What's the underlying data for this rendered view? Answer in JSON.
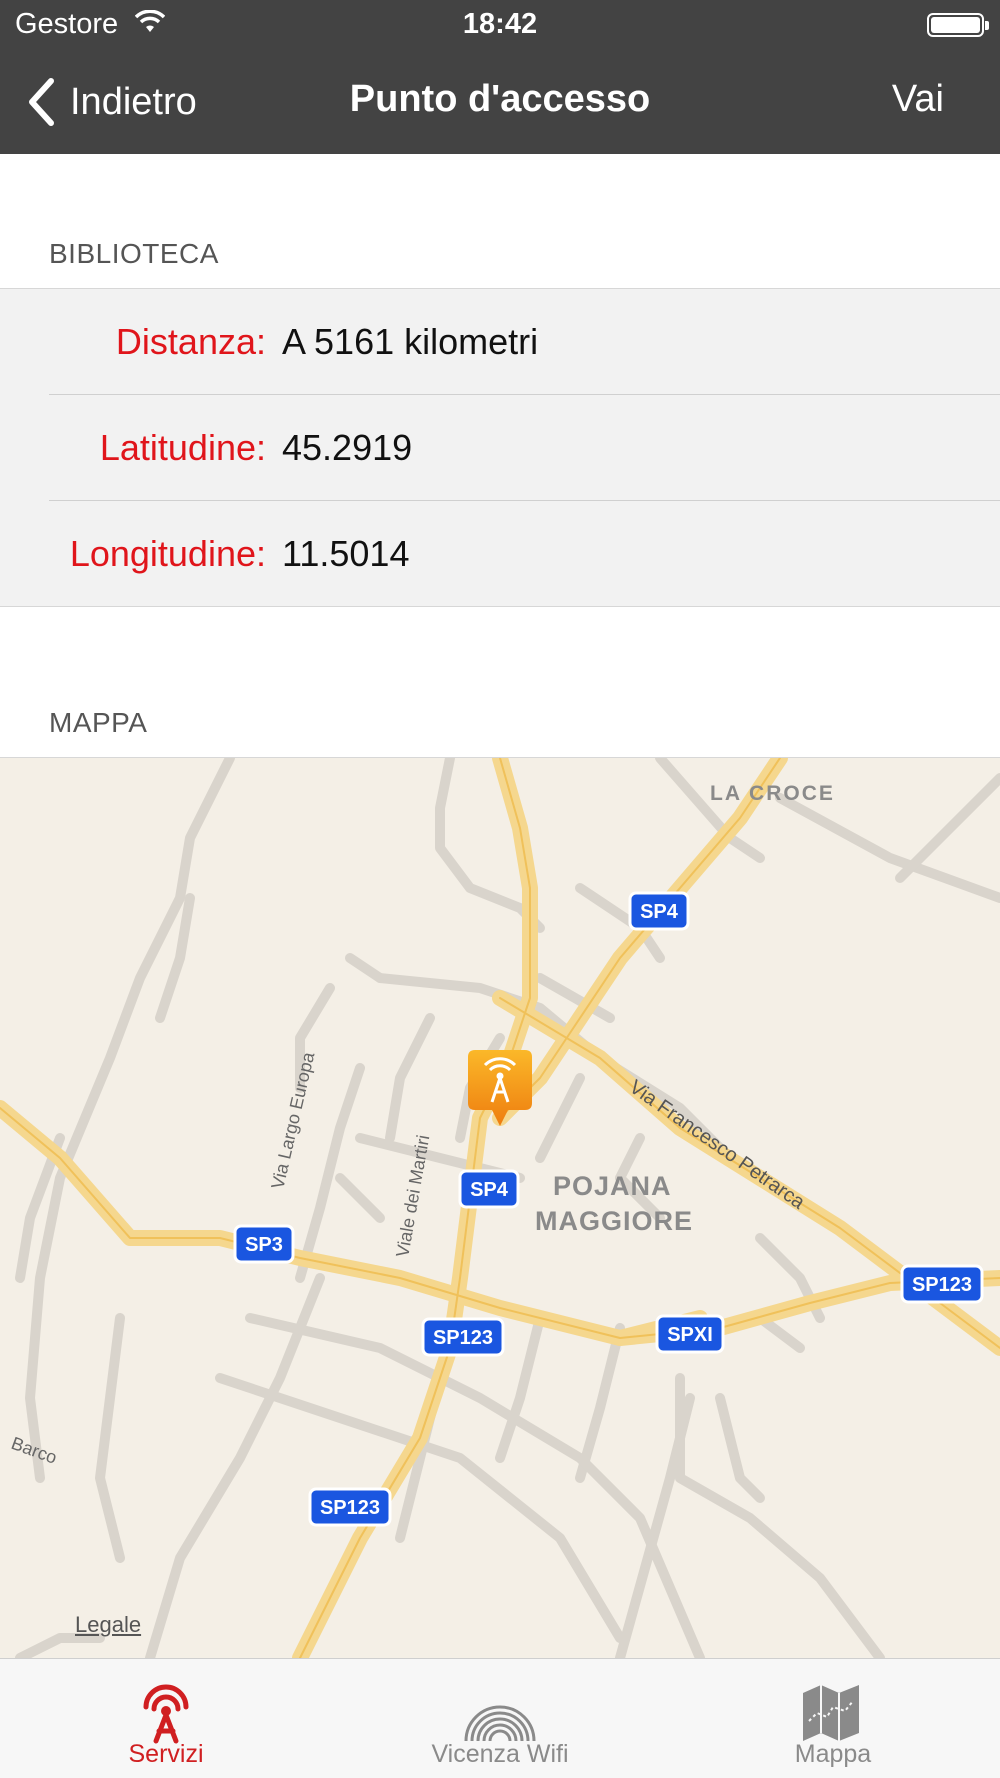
{
  "status_bar": {
    "carrier": "Gestore",
    "time": "18:42"
  },
  "nav": {
    "back_label": "Indietro",
    "title": "Punto d'accesso",
    "action_label": "Vai"
  },
  "info": {
    "section_title": "BIBLIOTECA",
    "rows": [
      {
        "key": "Distanza:",
        "value": "A 5161 kilometri"
      },
      {
        "key": "Latitudine:",
        "value": "45.2919"
      },
      {
        "key": "Longitudine:",
        "value": "11.5014"
      }
    ]
  },
  "map": {
    "section_title": "MAPPA",
    "legal": "Legale",
    "place_labels": [
      "LA CROCE",
      "POJANA",
      "MAGGIORE"
    ],
    "road_labels": [
      "Via Francesco Petrarca",
      "Via Largo Europa",
      "Viale dei Martiri",
      "Barco"
    ],
    "route_shields": [
      "SP4",
      "SP4",
      "SP3",
      "SP123",
      "SPXI",
      "SP123",
      "SP123"
    ],
    "pin_icon": "wifi-antenna-pin-icon"
  },
  "tabs": [
    {
      "label": "Servizi",
      "icon": "antenna-icon",
      "active": true
    },
    {
      "label": "Vicenza Wifi",
      "icon": "wifi-rings-icon",
      "active": false
    },
    {
      "label": "Mappa",
      "icon": "folded-map-icon",
      "active": false
    }
  ],
  "colors": {
    "nav_bar": "#434343",
    "accent": "#d01f21",
    "key_text": "#e0151b",
    "map_bg": "#f4efe6",
    "route_shield": "#1a56e0"
  }
}
